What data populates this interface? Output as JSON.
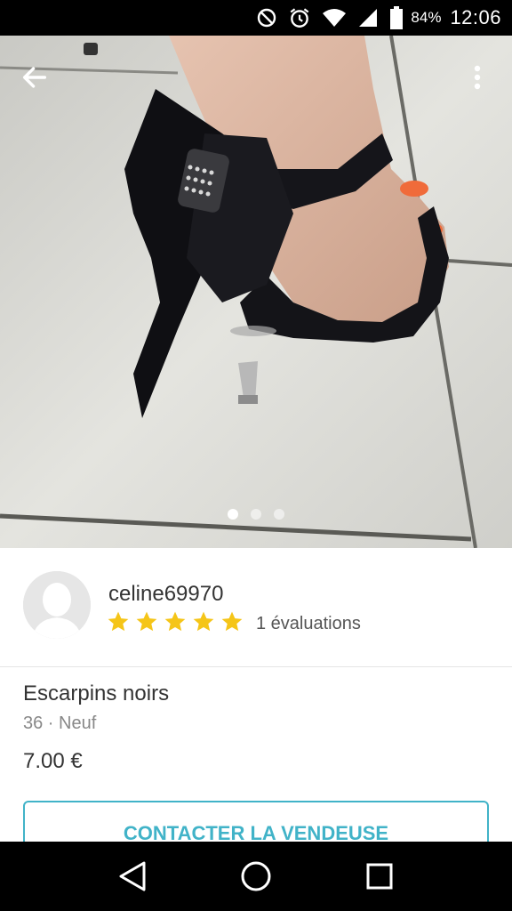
{
  "status_bar": {
    "battery_percent": "84%",
    "time": "12:06",
    "icons": [
      "do-not-disturb-icon",
      "alarm-icon",
      "wifi-icon",
      "cell-signal-icon",
      "battery-icon"
    ]
  },
  "photo": {
    "dots": [
      {
        "active": true
      },
      {
        "active": false
      },
      {
        "active": false
      }
    ],
    "back_icon": "arrow-left-icon",
    "more_icon": "more-vertical-icon"
  },
  "seller": {
    "username": "celine69970",
    "rating_stars": 5,
    "rating_max": 5,
    "rating_count_label": "1 évaluations",
    "star_color": "#f5c518"
  },
  "item": {
    "title": "Escarpins noirs",
    "meta": "36 · Neuf",
    "price": "7.00 €"
  },
  "actions": {
    "contact_label": "CONTACTER LA VENDEUSE",
    "accent_color": "#41b3c8"
  },
  "nav_bar": {
    "icons": [
      "back-triangle-icon",
      "home-circle-icon",
      "recents-square-icon"
    ]
  }
}
